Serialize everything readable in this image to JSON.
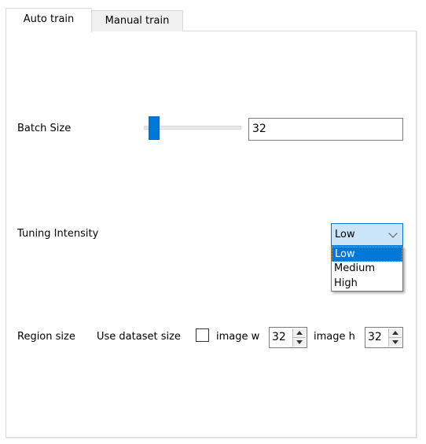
{
  "tabs": [
    {
      "label": "Auto train",
      "active": true
    },
    {
      "label": "Manual train",
      "active": false
    }
  ],
  "batch_size": {
    "label": "Batch Size",
    "value": "32",
    "slider_fraction": 0.1
  },
  "tuning_intensity": {
    "label": "Tuning Intensity",
    "selected": "Low",
    "options": [
      "Low",
      "Medium",
      "High"
    ],
    "highlighted": "Low"
  },
  "region_size": {
    "label": "Region size",
    "use_dataset_label": "Use dataset size",
    "use_dataset_checked": false,
    "image_w_label": "image w",
    "image_w_value": "32",
    "image_h_label": "image h",
    "image_h_value": "32"
  },
  "colors": {
    "accent": "#0078d7",
    "combo_bg": "#cce4f7"
  }
}
